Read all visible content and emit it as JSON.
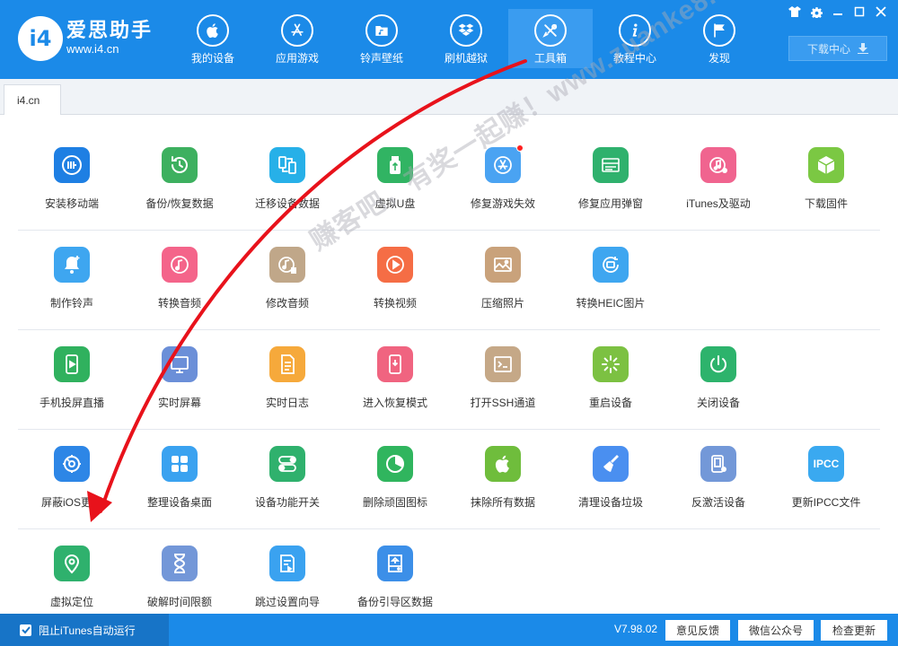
{
  "header": {
    "brand_name": "爱思助手",
    "brand_url": "www.i4.cn",
    "logo_text": "i4",
    "nav": [
      {
        "label": "我的设备",
        "icon": "apple-icon"
      },
      {
        "label": "应用游戏",
        "icon": "app-store-icon"
      },
      {
        "label": "铃声壁纸",
        "icon": "music-folder-icon"
      },
      {
        "label": "刷机越狱",
        "icon": "dropbox-icon"
      },
      {
        "label": "工具箱",
        "icon": "tools-icon",
        "active": true
      },
      {
        "label": "教程中心",
        "icon": "info-icon"
      },
      {
        "label": "发现",
        "icon": "flag-icon"
      }
    ],
    "download_label": "下载中心"
  },
  "tab": {
    "label": "i4.cn"
  },
  "tools": [
    [
      {
        "label": "安装移动端",
        "icon": "i4-logo-icon",
        "color": "#1e7fe3"
      },
      {
        "label": "备份/恢复数据",
        "icon": "backup-clock-icon",
        "color": "#3db05f"
      },
      {
        "label": "迁移设备数据",
        "icon": "migrate-phones-icon",
        "color": "#27b0e8"
      },
      {
        "label": "虚拟U盘",
        "icon": "usb-drive-icon",
        "color": "#31b463"
      },
      {
        "label": "修复游戏失效",
        "icon": "fix-appstore-icon",
        "color": "#4aa3f2",
        "dot": true
      },
      {
        "label": "修复应用弹窗",
        "icon": "apple-id-icon",
        "color": "#2fb16d"
      },
      {
        "label": "iTunes及驱动",
        "icon": "itunes-icon",
        "color": "#f0648f"
      },
      {
        "label": "下载固件",
        "icon": "firmware-box-icon",
        "color": "#7bc843"
      }
    ],
    [
      {
        "label": "制作铃声",
        "icon": "bell-icon",
        "color": "#3ea6f0"
      },
      {
        "label": "转换音频",
        "icon": "music-note-icon",
        "color": "#f4648a"
      },
      {
        "label": "修改音频",
        "icon": "edit-audio-icon",
        "color": "#c0a789"
      },
      {
        "label": "转换视频",
        "icon": "video-play-icon",
        "color": "#f56d45"
      },
      {
        "label": "压缩照片",
        "icon": "photo-icon",
        "color": "#c9a27b"
      },
      {
        "label": "转换HEIC图片",
        "icon": "heic-image-icon",
        "color": "#3ea6f0"
      }
    ],
    [
      {
        "label": "手机投屏直播",
        "icon": "phone-cast-icon",
        "color": "#30b15e"
      },
      {
        "label": "实时屏幕",
        "icon": "monitor-icon",
        "color": "#6b8fd8"
      },
      {
        "label": "实时日志",
        "icon": "log-document-icon",
        "color": "#f6a93b"
      },
      {
        "label": "进入恢复模式",
        "icon": "recovery-phone-icon",
        "color": "#f06480"
      },
      {
        "label": "打开SSH通道",
        "icon": "ssh-terminal-icon",
        "color": "#c5a887"
      },
      {
        "label": "重启设备",
        "icon": "restart-icon",
        "color": "#7cc142"
      },
      {
        "label": "关闭设备",
        "icon": "power-icon",
        "color": "#2db36c"
      }
    ],
    [
      {
        "label": "屏蔽iOS更新",
        "icon": "block-update-gear-icon",
        "color": "#2d86e6"
      },
      {
        "label": "整理设备桌面",
        "icon": "desktop-grid-icon",
        "color": "#3aa2f0"
      },
      {
        "label": "设备功能开关",
        "icon": "toggle-switch-icon",
        "color": "#2fb16d"
      },
      {
        "label": "删除顽固图标",
        "icon": "pie-icon",
        "color": "#30b55e"
      },
      {
        "label": "抹除所有数据",
        "icon": "erase-apple-icon",
        "color": "#6fbd3c"
      },
      {
        "label": "清理设备垃圾",
        "icon": "broom-icon",
        "color": "#4a8ff0"
      },
      {
        "label": "反激活设备",
        "icon": "deactivate-phone-icon",
        "color": "#7398d8"
      },
      {
        "label": "更新IPCC文件",
        "icon": "ipcc-icon",
        "color": "#3aa9f0",
        "icon_text": "IPCC"
      }
    ],
    [
      {
        "label": "虚拟定位",
        "icon": "location-pin-icon",
        "color": "#2fb16d"
      },
      {
        "label": "破解时间限额",
        "icon": "hourglass-icon",
        "color": "#7397d8"
      },
      {
        "label": "跳过设置向导",
        "icon": "skip-guide-icon",
        "color": "#3aa2f0"
      },
      {
        "label": "备份引导区数据",
        "icon": "boot-backup-icon",
        "color": "#3c8fe8"
      }
    ]
  ],
  "footer": {
    "itunes_label": "阻止iTunes自动运行",
    "version": "V7.98.02",
    "feedback": "意见反馈",
    "wechat": "微信公众号",
    "update": "检查更新"
  },
  "watermark": "赚客吧，有奖一起赚！www.zuanke8.com"
}
